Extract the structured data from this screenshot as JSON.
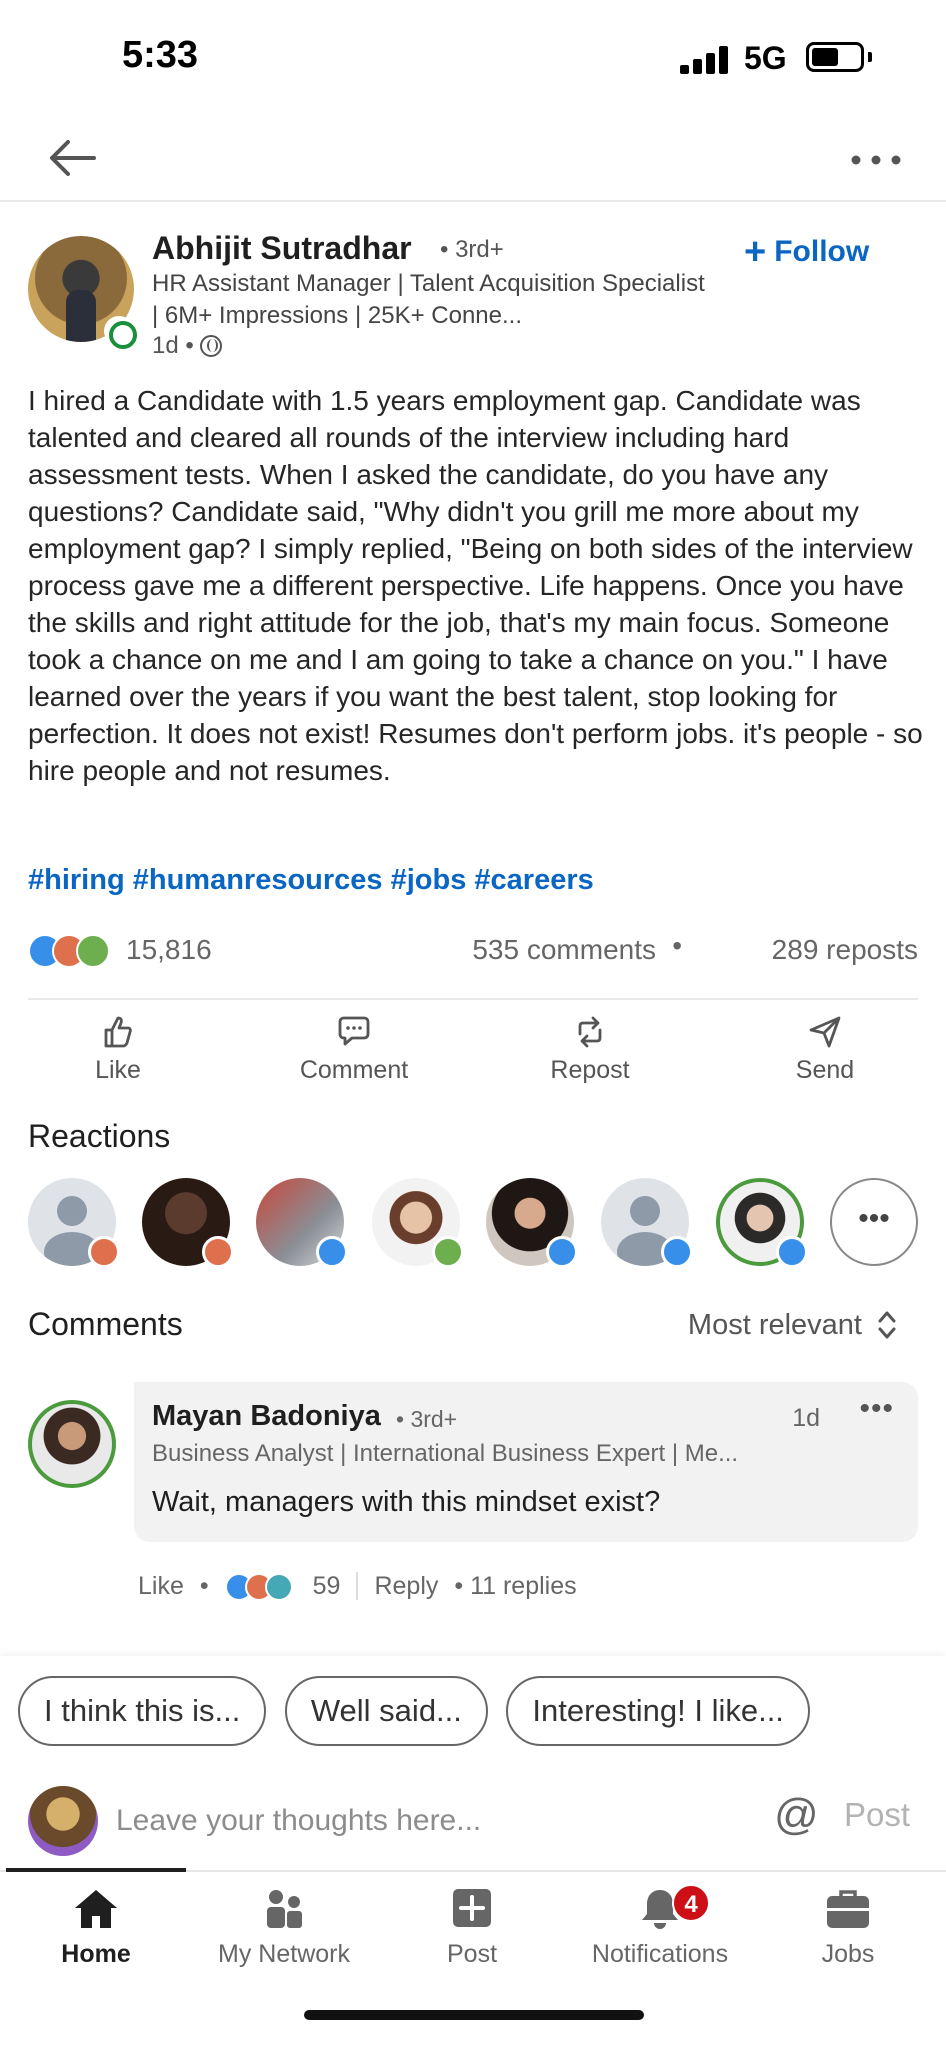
{
  "status_bar": {
    "time": "5:33",
    "network": "5G"
  },
  "author": {
    "name": "Abhijit Sutradhar",
    "degree": "• 3rd+",
    "headline": "HR Assistant Manager | Talent Acquisition Specialist | 6M+ Impressions | 25K+ Conne...",
    "time": "1d •",
    "follow_label": "Follow"
  },
  "post": {
    "body": "I hired a Candidate with 1.5 years employment gap. Candidate was talented and cleared all rounds of the interview including hard assessment tests. When I asked the candidate, do you have any questions? Candidate said, \"Why didn't you grill me more about my employment gap? I simply replied, \"Being on both sides of the interview process gave me a different perspective. Life happens. Once you have the skills and right attitude for the job, that's my main focus. Someone took a chance on me and I am going to take a chance on you.\" I have learned over the years if you want the best talent, stop looking for perfection. It does not exist! Resumes don't perform jobs. it's people - so hire people and not resumes.",
    "hashtags": "#hiring #humanresources #jobs #careers",
    "reaction_count": "15,816",
    "comments": "535 comments",
    "separator": "•",
    "reposts": "289 reposts"
  },
  "actions": {
    "like": "Like",
    "comment": "Comment",
    "repost": "Repost",
    "send": "Send"
  },
  "reactions_section": {
    "title": "Reactions",
    "more_label": "•••"
  },
  "comments_section": {
    "title": "Comments",
    "sort_label": "Most relevant"
  },
  "comment": {
    "name": "Mayan Badoniya",
    "degree": "• 3rd+",
    "time": "1d",
    "more_label": "•••",
    "headline": "Business Analyst | International Business Expert | Me...",
    "text": "Wait, managers with this mindset exist?",
    "like_label": "Like",
    "dot": "•",
    "reaction_count": "59",
    "reply_label": "Reply",
    "replies": "• 11 replies"
  },
  "suggestions": [
    "I think this is...",
    "Well said...",
    "Interesting! I like..."
  ],
  "compose": {
    "placeholder": "Leave your thoughts here...",
    "mention": "@",
    "post_label": "Post"
  },
  "bottom_nav": {
    "home": "Home",
    "network": "My Network",
    "post": "Post",
    "notifications": "Notifications",
    "notifications_badge": "4",
    "jobs": "Jobs"
  },
  "colors": {
    "accent": "#0a66c2",
    "like": "#378fe9",
    "love": "#df704d",
    "support": "#6dae4f",
    "badge": "#cc1016"
  }
}
